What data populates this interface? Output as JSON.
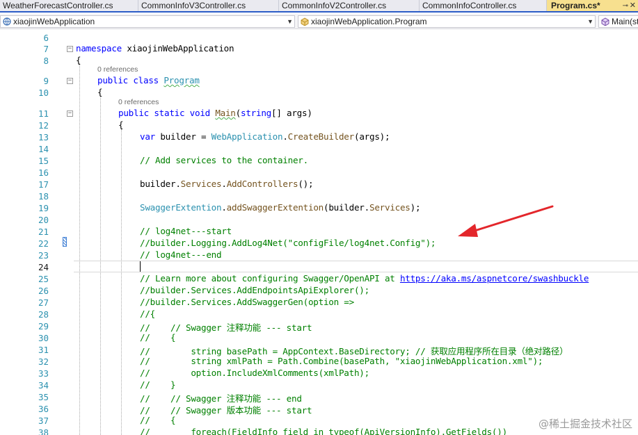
{
  "tabs": [
    {
      "label": "WeatherForecastController.cs",
      "active": false
    },
    {
      "label": "CommonInfoV3Controller.cs",
      "active": false
    },
    {
      "label": "CommonInfoV2Controller.cs",
      "active": false
    },
    {
      "label": "CommonInfoController.cs",
      "active": false
    },
    {
      "label": "Program.cs*",
      "active": true
    }
  ],
  "nav": {
    "project": "xiaojinWebApplication",
    "type": "xiaojinWebApplication.Program",
    "member": "Main(st"
  },
  "editor": {
    "current_line": 24,
    "lens": {
      "program_refs": "0 references",
      "main_refs": "0 references"
    },
    "lines": [
      {
        "n": 6,
        "segs": []
      },
      {
        "n": 7,
        "segs": [
          [
            "kw",
            "namespace"
          ],
          [
            "",
            "xiaojinWebApplication"
          ]
        ]
      },
      {
        "n": 8,
        "segs": [
          [
            "",
            "{"
          ]
        ]
      },
      {
        "n": 9,
        "segs": [
          [
            "kw",
            "public class "
          ],
          [
            "ty squig",
            "Program"
          ]
        ]
      },
      {
        "n": 10,
        "segs": [
          [
            "",
            "{"
          ]
        ]
      },
      {
        "n": 11,
        "segs": [
          [
            "kw",
            "public static void "
          ],
          [
            "mt squig",
            "Main"
          ],
          [
            "",
            "("
          ],
          [
            "kw",
            "string"
          ],
          [
            "",
            "[] args)"
          ]
        ]
      },
      {
        "n": 12,
        "segs": [
          [
            "",
            "{"
          ]
        ]
      },
      {
        "n": 13,
        "segs": [
          [
            "kw",
            "var"
          ],
          [
            "",
            " builder = "
          ],
          [
            "ty",
            "WebApplication"
          ],
          [
            "",
            "."
          ],
          [
            "mt",
            "CreateBuilder"
          ],
          [
            "",
            "(args);"
          ]
        ]
      },
      {
        "n": 14,
        "segs": []
      },
      {
        "n": 15,
        "segs": [
          [
            "cm",
            "// Add services to the container."
          ]
        ]
      },
      {
        "n": 16,
        "segs": []
      },
      {
        "n": 17,
        "segs": [
          [
            "",
            "builder."
          ],
          [
            "mt",
            "Services"
          ],
          [
            "",
            "."
          ],
          [
            "mt",
            "AddControllers"
          ],
          [
            "",
            "();"
          ]
        ]
      },
      {
        "n": 18,
        "segs": []
      },
      {
        "n": 19,
        "segs": [
          [
            "ty",
            "SwaggerExtention"
          ],
          [
            "",
            "."
          ],
          [
            "mt",
            "addSwaggerExtention"
          ],
          [
            "",
            "(builder."
          ],
          [
            "mt",
            "Services"
          ],
          [
            "",
            ");"
          ]
        ]
      },
      {
        "n": 20,
        "segs": []
      },
      {
        "n": 21,
        "segs": [
          [
            "cm",
            "// log4net---start"
          ]
        ]
      },
      {
        "n": 22,
        "segs": [
          [
            "cm",
            "//builder.Logging.AddLog4Net(\"configFile/log4net.Config\");"
          ]
        ]
      },
      {
        "n": 23,
        "segs": [
          [
            "cm",
            "// log4net---end"
          ]
        ]
      },
      {
        "n": 24,
        "segs": []
      },
      {
        "n": 25,
        "segs": [
          [
            "cm",
            "// Learn more about configuring Swagger/OpenAPI at "
          ],
          [
            "lk",
            "https://aka.ms/aspnetcore/swashbuckle"
          ]
        ]
      },
      {
        "n": 26,
        "segs": [
          [
            "cm",
            "//builder.Services.AddEndpointsApiExplorer();"
          ]
        ]
      },
      {
        "n": 27,
        "segs": [
          [
            "cm",
            "//builder.Services.AddSwaggerGen(option =>"
          ]
        ]
      },
      {
        "n": 28,
        "segs": [
          [
            "cm",
            "//{"
          ]
        ]
      },
      {
        "n": 29,
        "segs": [
          [
            "cm",
            "//    // Swagger 注释功能 --- start"
          ]
        ]
      },
      {
        "n": 30,
        "segs": [
          [
            "cm",
            "//    {"
          ]
        ]
      },
      {
        "n": 31,
        "segs": [
          [
            "cm",
            "//        string basePath = AppContext.BaseDirectory; // 获取应用程序所在目录（绝对路径）"
          ]
        ]
      },
      {
        "n": 32,
        "segs": [
          [
            "cm",
            "//        string xmlPath = Path.Combine(basePath, \"xiaojinWebApplication.xml\");"
          ]
        ]
      },
      {
        "n": 33,
        "segs": [
          [
            "cm",
            "//        option.IncludeXmlComments(xmlPath);"
          ]
        ]
      },
      {
        "n": 34,
        "segs": [
          [
            "cm",
            "//    }"
          ]
        ]
      },
      {
        "n": 35,
        "segs": [
          [
            "cm",
            "//    // Swagger 注释功能 --- end"
          ]
        ]
      },
      {
        "n": 36,
        "segs": [
          [
            "cm",
            "//    // Swagger 版本功能 --- start"
          ]
        ]
      },
      {
        "n": 37,
        "segs": [
          [
            "cm",
            "//    {"
          ]
        ]
      },
      {
        "n": 38,
        "segs": [
          [
            "cm",
            "//        foreach(FieldInfo field in typeof(ApiVersionInfo).GetFields())"
          ]
        ]
      }
    ]
  },
  "watermark": "@稀土掘金技术社区",
  "colors": {
    "arrow": "#e3262b",
    "active_tab": "#f7e08f",
    "tab_accent": "#2c5cc7"
  }
}
